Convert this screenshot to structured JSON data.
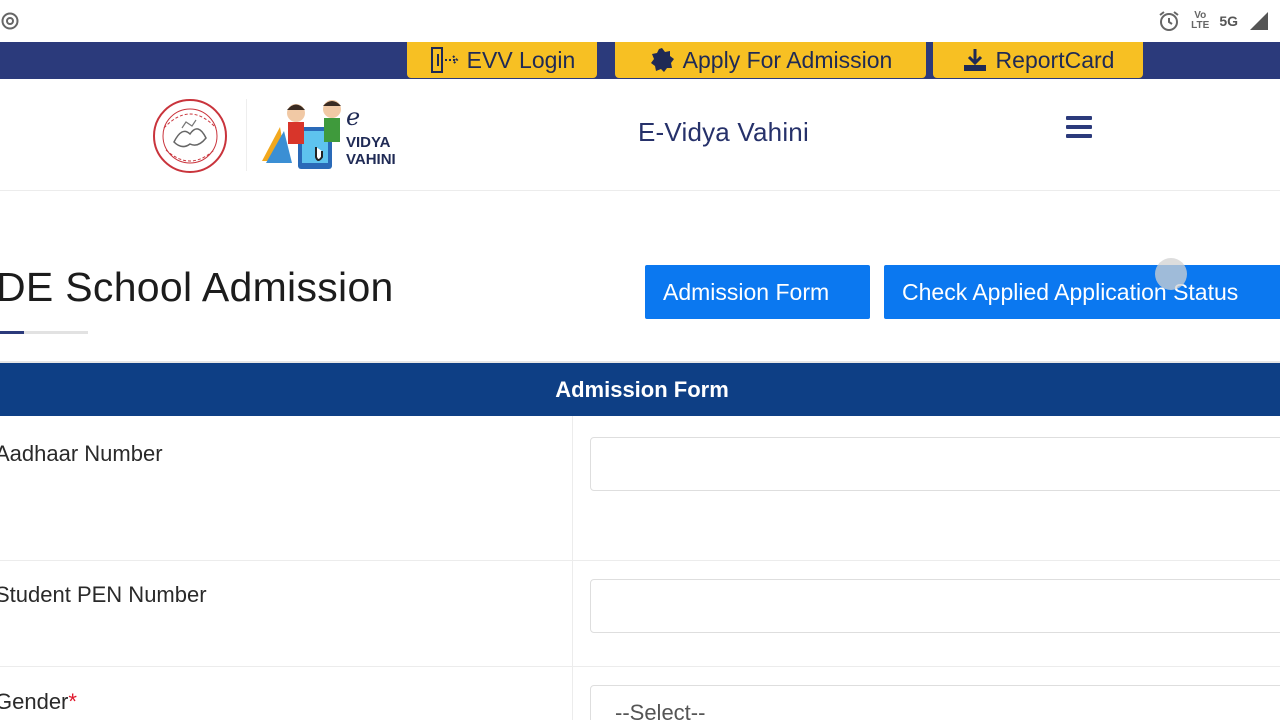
{
  "status_bar": {
    "left_icon": "settings-gear-icon",
    "right_icons": [
      "alarm-icon",
      "volte-indicator",
      "signal-icon"
    ],
    "volte_line1": "Vo",
    "volte_line2": "LTE",
    "network": "5G"
  },
  "top_nav": {
    "buttons": [
      {
        "label": "EVV Login",
        "icon": "login-door-icon"
      },
      {
        "label": "Apply For Admission",
        "icon": "seal-badge-icon"
      },
      {
        "label": "ReportCard",
        "icon": "download-icon"
      }
    ]
  },
  "header": {
    "site_title": "E-Vidya Vahini",
    "logo_text_e": "e",
    "logo_text_line1": "VIDYA",
    "logo_text_line2": "VAHINI"
  },
  "page": {
    "title": "DE School Admission",
    "buttons": {
      "admission_form": "Admission Form",
      "check_status": "Check Applied Application Status"
    }
  },
  "form": {
    "header": "Admission Form",
    "fields": [
      {
        "label": "Aadhaar Number",
        "value": "",
        "required": false
      },
      {
        "label": "Student PEN Number",
        "value": "",
        "required": false
      },
      {
        "label": "Gender",
        "value": "--Select--",
        "required": true,
        "required_mark": "*"
      }
    ]
  },
  "colors": {
    "navy": "#2b3a7b",
    "yellow": "#f7c023",
    "blue_button": "#0b78f0",
    "form_header": "#0e3f85",
    "required": "#e0162b"
  }
}
